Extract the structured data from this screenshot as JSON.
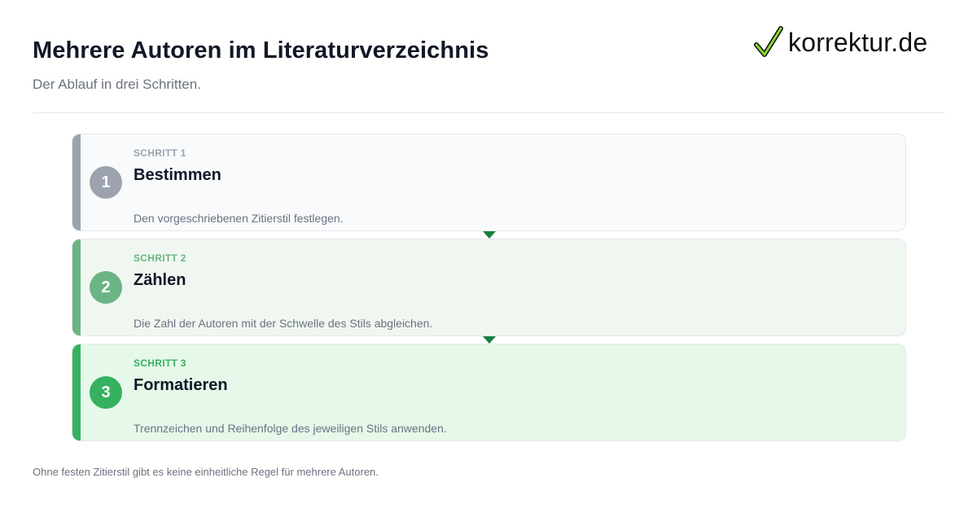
{
  "header": {
    "title": "Mehrere Autoren im Literaturverzeichnis",
    "subtitle": "Der Ablauf in drei Schritten."
  },
  "logo": {
    "text": "korrektur.de",
    "icon": "checkmark-icon"
  },
  "steps": [
    {
      "number": "1",
      "kicker": "SCHRITT 1",
      "title": "Bestimmen",
      "description": "Den vorgeschriebenen Zitierstil festlegen.",
      "color": "#9ca3af"
    },
    {
      "number": "2",
      "kicker": "SCHRITT 2",
      "title": "Zählen",
      "description": "Die Zahl der Autoren mit der Schwelle des Stils abgleichen.",
      "color": "#6bb584"
    },
    {
      "number": "3",
      "kicker": "SCHRITT 3",
      "title": "Formatieren",
      "description": "Trennzeichen und Reihenfolge des jeweiligen Stils anwenden.",
      "color": "#35b160"
    }
  ],
  "footnote": "Ohne festen Zitierstil gibt es keine einheitliche Regel für mehrere Autoren."
}
